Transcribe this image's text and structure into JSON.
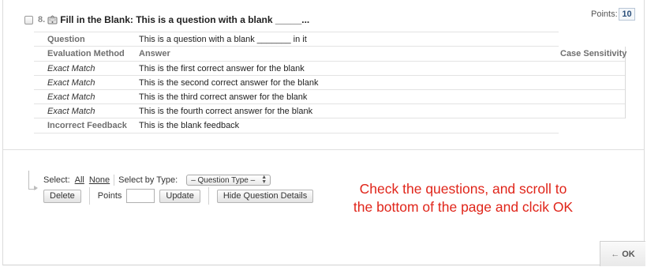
{
  "question": {
    "number": "8.",
    "title": "Fill in the Blank: This is a question with a blank _____...",
    "points_label": "Points:",
    "points_value": "10"
  },
  "details": {
    "question_label": "Question",
    "question_text": "This is a question with a blank _______ in it",
    "headers": {
      "evaluation": "Evaluation Method",
      "answer": "Answer",
      "case": "Case Sensitivity"
    },
    "answers": [
      {
        "method": "Exact Match",
        "answer": "This is the first correct answer for the blank"
      },
      {
        "method": "Exact Match",
        "answer": "This is the second correct answer for the blank"
      },
      {
        "method": "Exact Match",
        "answer": "This is the third correct answer for the blank"
      },
      {
        "method": "Exact Match",
        "answer": "This is the fourth correct answer for the blank"
      }
    ],
    "feedback_label": "Incorrect Feedback",
    "feedback_text": "This is the blank feedback"
  },
  "actions": {
    "select_label": "Select:",
    "all_link": "All",
    "none_link": "None",
    "select_by_type_label": "Select by Type:",
    "type_select_value": "– Question Type –",
    "delete_button": "Delete",
    "points_label": "Points",
    "points_input_value": "",
    "update_button": "Update",
    "hide_details_button": "Hide Question Details"
  },
  "instruction": "Check the questions, and scroll to the bottom of the page and clcik OK",
  "ok_button": "OK",
  "colors": {
    "instruction_text": "#e0251a",
    "points_value": "#2a4f7a"
  }
}
